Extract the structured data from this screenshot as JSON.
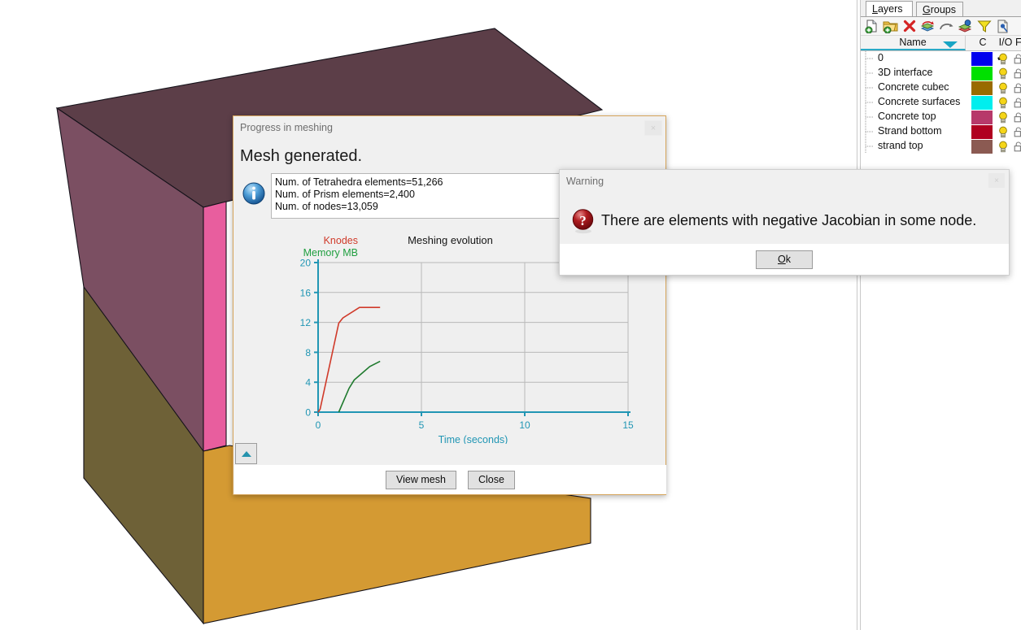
{
  "viewport": {
    "name": "3d-model-viewport",
    "faces": [
      {
        "name": "top-face",
        "color": "#5c3e48"
      },
      {
        "name": "left-upper-face",
        "color": "#7b4f62"
      },
      {
        "name": "left-lower-face",
        "color": "#6e6137"
      },
      {
        "name": "front-pink-face",
        "color": "#e85e9e"
      },
      {
        "name": "front-bottom-face",
        "color": "#d49a33"
      }
    ]
  },
  "layers_panel": {
    "tabs": [
      {
        "label": "Layers",
        "accel": "L",
        "active": true
      },
      {
        "label": "Groups",
        "accel": "G",
        "active": false
      }
    ],
    "toolbar": [
      {
        "name": "new-layer-icon",
        "tip": "New layer"
      },
      {
        "name": "new-group-icon",
        "tip": "New group"
      },
      {
        "name": "delete-layer-icon",
        "tip": "Delete"
      },
      {
        "name": "layer-to-use-icon",
        "tip": "Set to use"
      },
      {
        "name": "send-to-layer-icon",
        "tip": "Send to"
      },
      {
        "name": "select-layer-icon",
        "tip": "Select entities"
      },
      {
        "name": "filter-icon",
        "tip": "Filter"
      },
      {
        "name": "properties-icon",
        "tip": "Properties"
      }
    ],
    "columns": {
      "name": "Name",
      "c": "C",
      "io": "I/O",
      "f": "F"
    },
    "rows": [
      {
        "name": "0",
        "color": "#0000ee",
        "current": true
      },
      {
        "name": "3D interface",
        "color": "#00e000",
        "current": false
      },
      {
        "name": "Concrete cubec",
        "color": "#996b00",
        "current": false
      },
      {
        "name": "Concrete surfaces",
        "color": "#00eeee",
        "current": false
      },
      {
        "name": "Concrete top",
        "color": "#b7396a",
        "current": false
      },
      {
        "name": "Strand bottom",
        "color": "#b00020",
        "current": false
      },
      {
        "name": "strand top",
        "color": "#8b5a52",
        "current": false
      }
    ]
  },
  "progress_dialog": {
    "title": "Progress in meshing",
    "close_label": "×",
    "heading": "Mesh generated.",
    "info_icon": "info-icon",
    "info_lines": [
      "Num. of Tetrahedra elements=51,266",
      "Num. of Prism elements=2,400",
      "Num. of nodes=13,059"
    ],
    "collapse_icon": "collapse-up-icon",
    "buttons": [
      {
        "label": "View mesh",
        "name": "view-mesh-button"
      },
      {
        "label": "Close",
        "name": "close-button"
      }
    ]
  },
  "warning_dialog": {
    "title": "Warning",
    "close_label": "×",
    "icon": "question-warning-icon",
    "message": "There are elements with negative Jacobian in some node.",
    "ok_label": "Ok",
    "ok_accel": "O"
  },
  "chart_data": {
    "type": "line",
    "title": "Meshing evolution",
    "xlabel": "Time (seconds)",
    "ylabel": "",
    "xlim": [
      0,
      15
    ],
    "ylim": [
      0,
      20
    ],
    "xticks": [
      0,
      5,
      10,
      15
    ],
    "yticks": [
      0,
      4,
      8,
      12,
      16,
      20
    ],
    "grid": true,
    "legend_position": "top-left",
    "axis_color": "#2196b4",
    "grid_color": "#b9b9b9",
    "plot_bg": "#efefef",
    "series": [
      {
        "name": "Knodes",
        "color": "#d03a2a",
        "x": [
          0.0,
          0.1,
          1.0,
          1.2,
          2.0,
          3.0
        ],
        "y": [
          0.0,
          0.4,
          11.9,
          12.6,
          14.0,
          14.0
        ]
      },
      {
        "name": "Memory MB",
        "color": "#1f7a2e",
        "x": [
          1.0,
          1.5,
          1.75,
          2.0,
          2.5,
          3.0
        ],
        "y": [
          0.0,
          3.2,
          4.3,
          4.9,
          6.1,
          6.8
        ]
      }
    ]
  }
}
